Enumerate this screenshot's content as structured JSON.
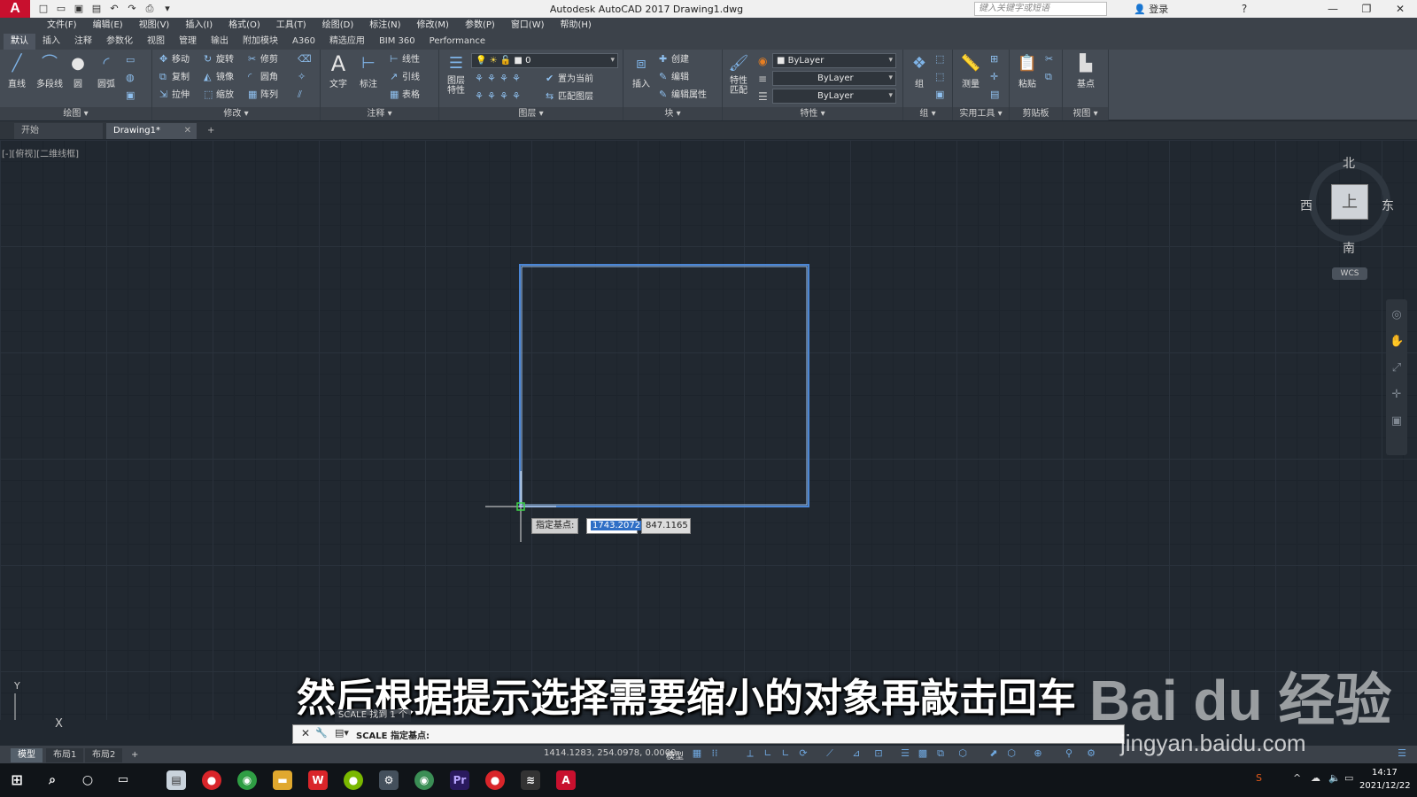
{
  "titlebar": {
    "logo": "A",
    "window_title": "Autodesk AutoCAD 2017    Drawing1.dwg",
    "search_placeholder": "键入关键字或短语",
    "login": "登录"
  },
  "menus": [
    "文件(F)",
    "编辑(E)",
    "视图(V)",
    "插入(I)",
    "格式(O)",
    "工具(T)",
    "绘图(D)",
    "标注(N)",
    "修改(M)",
    "参数(P)",
    "窗口(W)",
    "帮助(H)"
  ],
  "ribbon_tabs": [
    "默认",
    "插入",
    "注释",
    "参数化",
    "视图",
    "管理",
    "输出",
    "附加模块",
    "A360",
    "精选应用",
    "BIM 360",
    "Performance"
  ],
  "ribbon": {
    "draw": {
      "title": "绘图 ▾",
      "line": "直线",
      "polyline": "多段线",
      "circle": "圆",
      "arc": "圆弧"
    },
    "modify": {
      "title": "修改 ▾",
      "move": "移动",
      "rotate": "旋转",
      "trim": "修剪",
      "copy": "复制",
      "mirror": "镜像",
      "fillet": "圆角",
      "stretch": "拉伸",
      "scale": "缩放",
      "array": "阵列"
    },
    "annotation": {
      "title": "注释 ▾",
      "text": "文字",
      "dimension": "标注",
      "linear": "线性",
      "leader": "引线",
      "table": "表格"
    },
    "layers": {
      "title": "图层 ▾",
      "properties": "图层\n特性",
      "layer_combo": "0",
      "make_current": "置为当前",
      "match_layer": "匹配图层"
    },
    "block": {
      "title": "块 ▾",
      "insert": "插入",
      "create": "创建",
      "edit": "编辑",
      "edit_attr": "编辑属性"
    },
    "properties": {
      "title": "特性 ▾",
      "match": "特性\n匹配",
      "color": "ByLayer",
      "linetype": "ByLayer",
      "lineweight": "ByLayer"
    },
    "groups": {
      "title": "组 ▾",
      "group": "组"
    },
    "utilities": {
      "title": "实用工具 ▾",
      "measure": "测量"
    },
    "clipboard": {
      "title": "剪贴板",
      "paste": "粘贴"
    },
    "view": {
      "title": "视图 ▾",
      "base": "基点"
    }
  },
  "doc_tabs": {
    "start": "开始",
    "drawing": "Drawing1*",
    "add": "+"
  },
  "viewport_label": "[-][俯视][二维线框]",
  "viewcube": {
    "top": "上",
    "north": "北",
    "south": "南",
    "east": "东",
    "west": "西",
    "wcs": "WCS"
  },
  "ucs": {
    "x": "X",
    "y": "Y"
  },
  "dynamic_input": {
    "label": "指定基点:",
    "x_value": "1743.2072",
    "y_value": "847.1165"
  },
  "command": {
    "history": "SCALE 找到 1 个",
    "prompt": "SCALE 指定基点:"
  },
  "subtitle": "然后根据提示选择需要缩小的对象再敲击回车",
  "watermark": {
    "logo": "Bai du 经验",
    "url": "jingyan.baidu.com"
  },
  "layout_tabs": [
    "模型",
    "布局1",
    "布局2",
    "+"
  ],
  "status": {
    "coords": "1414.1283, 254.0978, 0.0000",
    "model": "模型"
  },
  "taskbar": {
    "time": "14:17",
    "date": "2021/12/22"
  }
}
